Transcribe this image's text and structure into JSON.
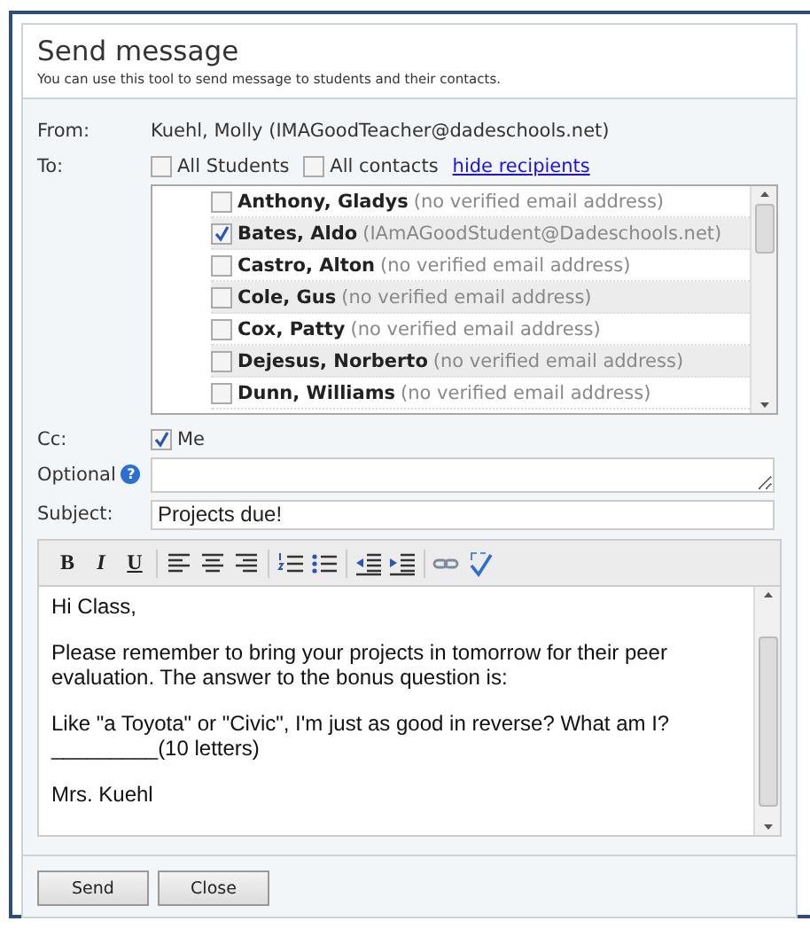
{
  "dialog": {
    "title": "Send message",
    "subtitle": "You can use this tool to send message to students and their contacts."
  },
  "from": {
    "label": "From:",
    "value": "Kuehl, Molly (IMAGoodTeacher@dadeschools.net)"
  },
  "to": {
    "label": "To:",
    "options": [
      {
        "label": "All Students",
        "checked": false
      },
      {
        "label": "All contacts",
        "checked": false
      }
    ],
    "link": "hide recipients",
    "recipients": [
      {
        "name": "Anthony, Gladys",
        "detail": "(no verified email address)",
        "checked": false
      },
      {
        "name": "Bates, Aldo",
        "detail": "(IAmAGoodStudent@Dadeschools.net)",
        "checked": true
      },
      {
        "name": "Castro, Alton",
        "detail": "(no verified email address)",
        "checked": false
      },
      {
        "name": "Cole, Gus",
        "detail": "(no verified email address)",
        "checked": false
      },
      {
        "name": "Cox, Patty",
        "detail": "(no verified email address)",
        "checked": false
      },
      {
        "name": "Dejesus, Norberto",
        "detail": "(no verified email address)",
        "checked": false
      },
      {
        "name": "Dunn, Williams",
        "detail": "(no verified email address)",
        "checked": false
      }
    ]
  },
  "cc": {
    "label": "Cc:",
    "option": {
      "label": "Me",
      "checked": true
    }
  },
  "optional": {
    "label": "Optional",
    "help": "?"
  },
  "subject": {
    "label": "Subject:",
    "value": "Projects due!"
  },
  "toolbar": [
    [
      {
        "kind": "text",
        "label": "B"
      },
      {
        "kind": "text",
        "label": "I"
      },
      {
        "kind": "text",
        "label": "U"
      }
    ],
    [
      {
        "kind": "align-left"
      },
      {
        "kind": "align-center"
      },
      {
        "kind": "align-right"
      }
    ],
    [
      {
        "kind": "numbered-list"
      },
      {
        "kind": "bullet-list"
      }
    ],
    [
      {
        "kind": "outdent"
      },
      {
        "kind": "indent"
      }
    ],
    [
      {
        "kind": "link"
      },
      {
        "kind": "spellcheck"
      }
    ]
  ],
  "body": [
    {
      "lines": [
        "Hi Class,"
      ]
    },
    {
      "lines": [
        "Please remember to bring your projects in tomorrow for their peer",
        "evaluation.  The answer to the bonus question is:"
      ]
    },
    {
      "lines": [
        "Like \"a Toyota\" or \"Civic\", I'm just as good in reverse? What am I?",
        "_________(10 letters)"
      ]
    },
    {
      "lines": [
        "Mrs. Kuehl"
      ]
    }
  ],
  "buttons": [
    "Send",
    "Close"
  ]
}
